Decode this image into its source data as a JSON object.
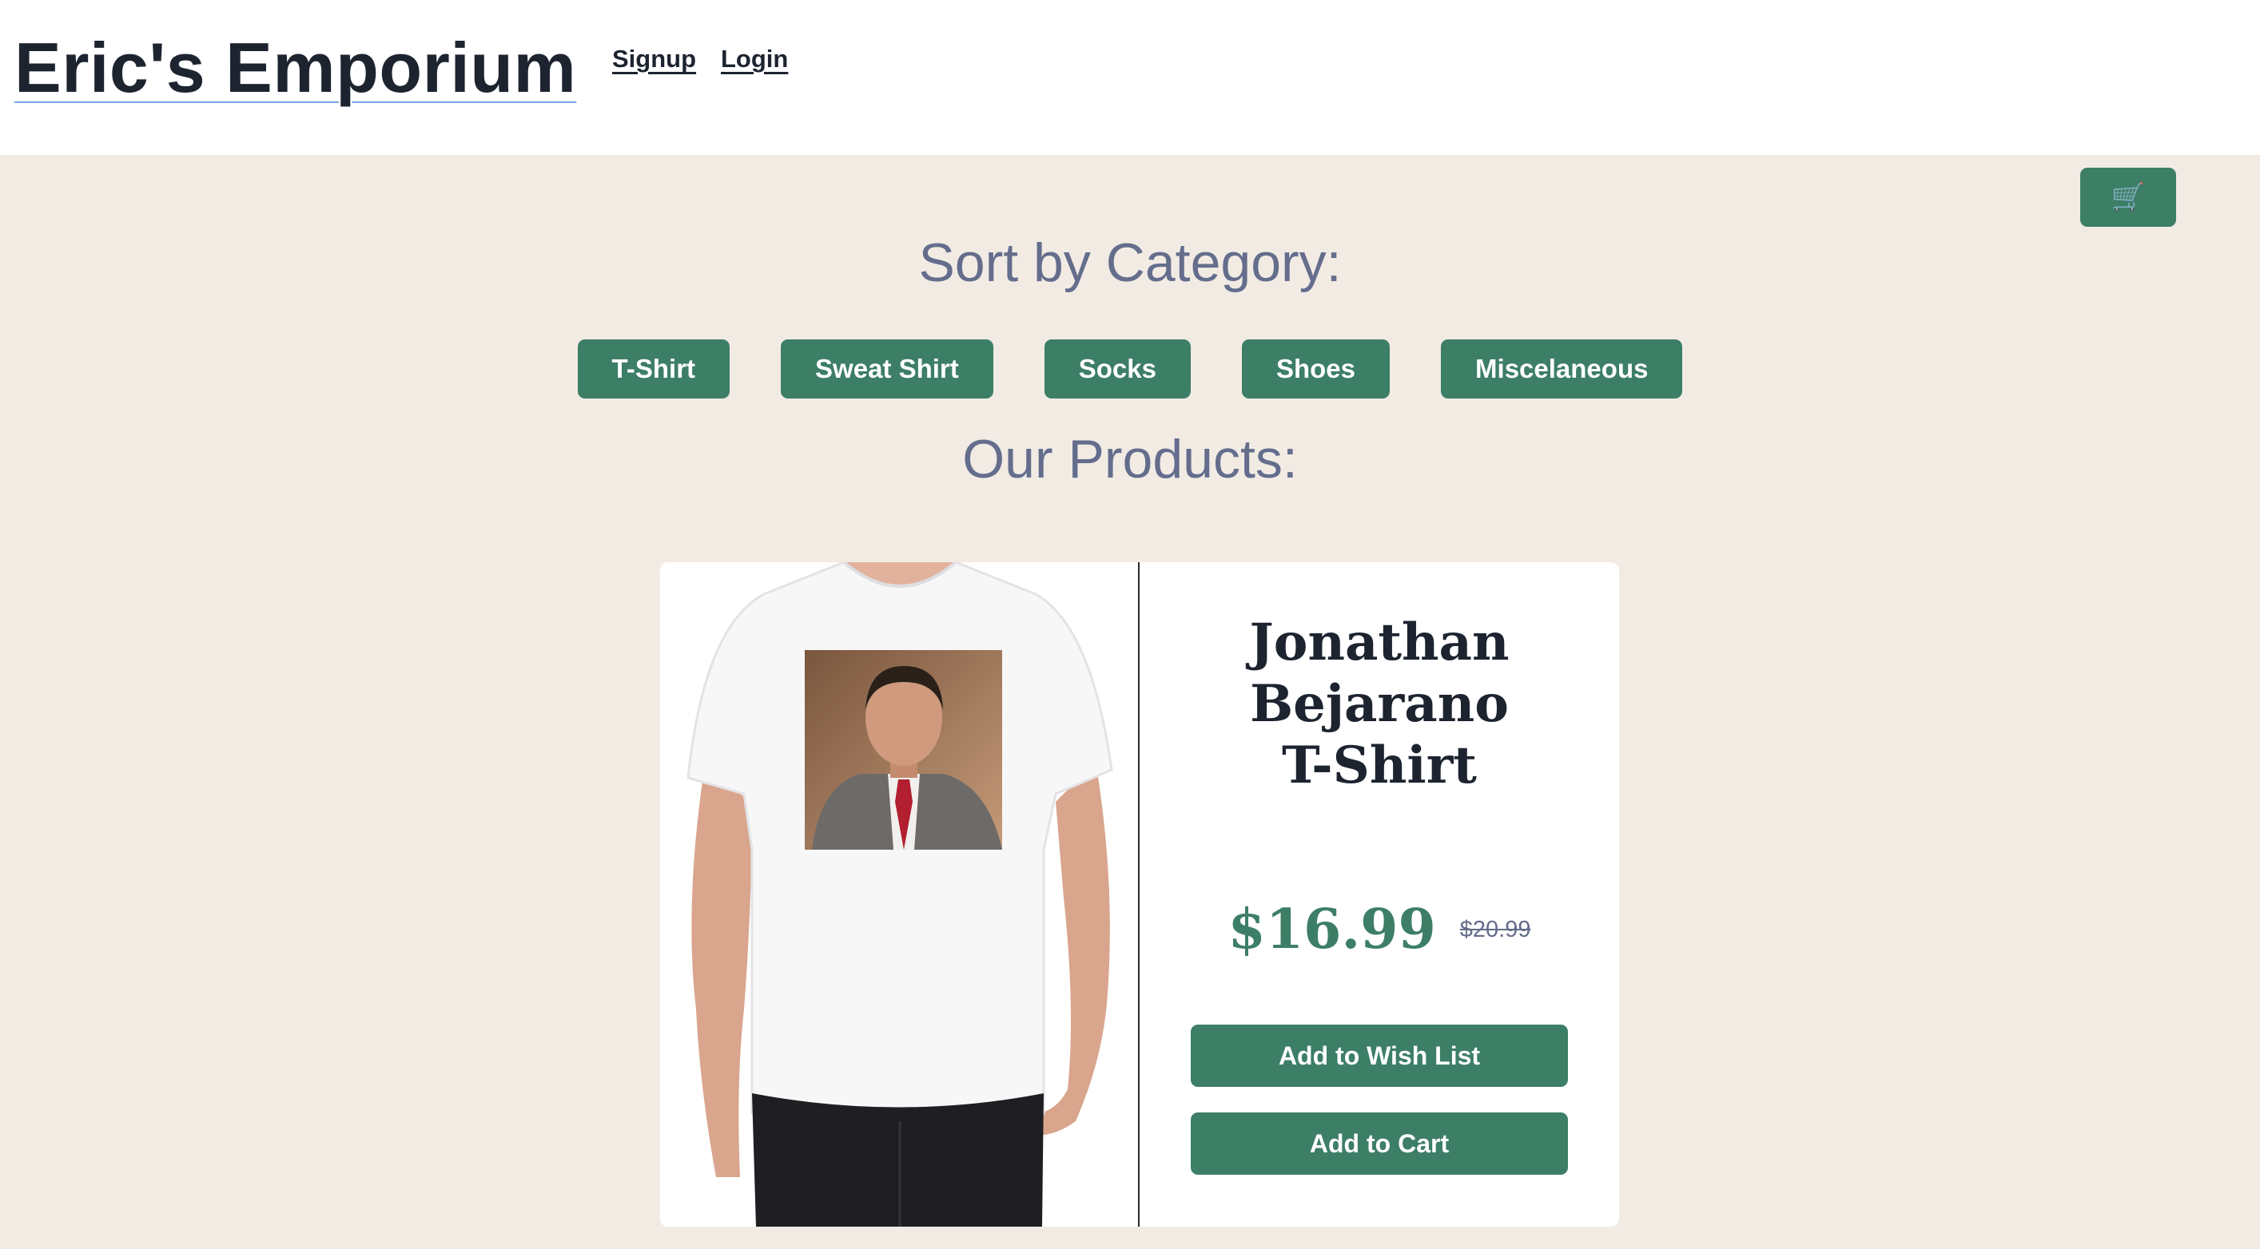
{
  "header": {
    "brand": "Eric's Emporium",
    "nav": {
      "signup": "Signup",
      "login": "Login"
    }
  },
  "cart": {
    "icon": "cart-icon",
    "glyph": "🛒"
  },
  "categories": {
    "title": "Sort by Category:",
    "items": [
      "T-Shirt",
      "Sweat Shirt",
      "Socks",
      "Shoes",
      "Miscelaneous"
    ]
  },
  "products": {
    "title": "Our Products:",
    "items": [
      {
        "name_lines": [
          "Jonathan",
          "Bejarano",
          "T-Shirt"
        ],
        "price": "$16.99",
        "old_price": "$20.99",
        "wishlist_label": "Add to Wish List",
        "cart_label": "Add to Cart"
      }
    ]
  },
  "colors": {
    "accent": "#3d7e66",
    "background": "#f1ebe4",
    "heading": "#646d8c"
  }
}
